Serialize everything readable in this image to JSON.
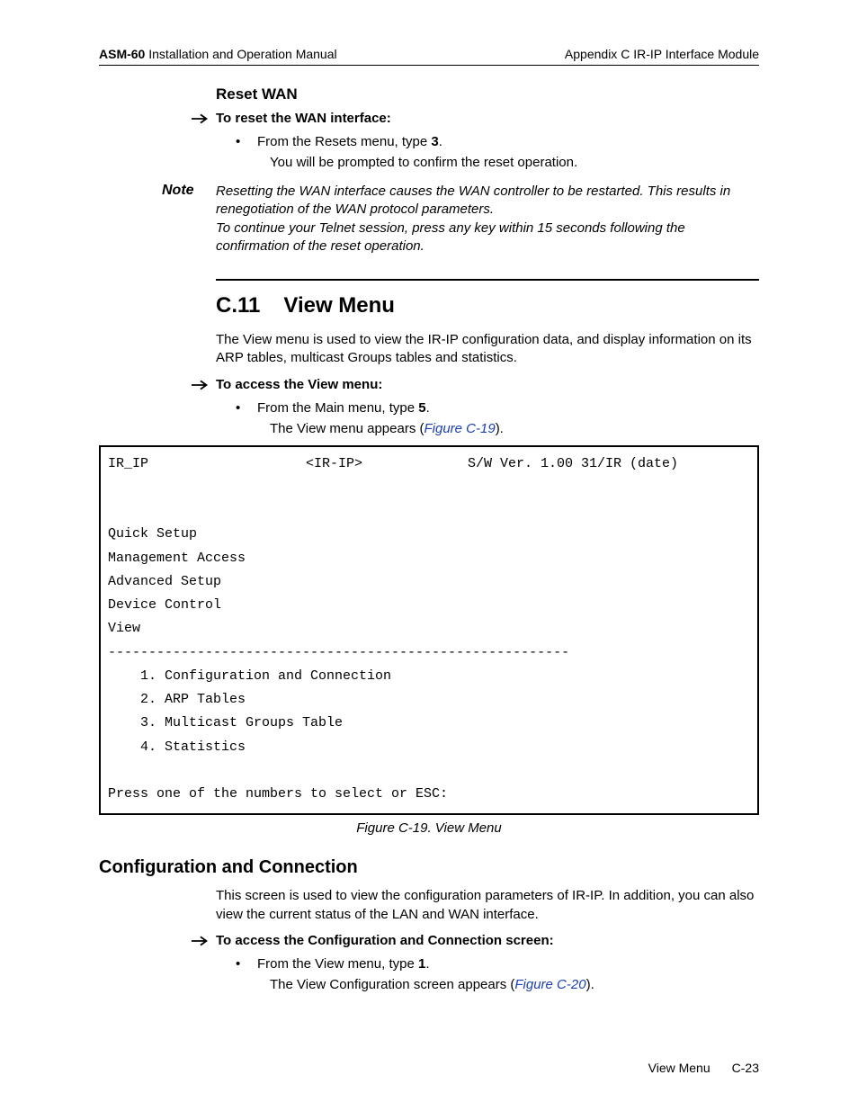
{
  "header": {
    "product": "ASM-60",
    "manual": " Installation and Operation Manual",
    "appendix": "Appendix C  IR-IP Interface Module"
  },
  "reset_wan": {
    "title": "Reset WAN",
    "proc": "To reset the WAN interface:",
    "step_pre": "From the Resets menu, type ",
    "step_bold": "3",
    "step_post": ".",
    "result": "You will be prompted to confirm the reset operation.",
    "note_label": "Note",
    "note_body1": "Resetting the WAN interface causes the WAN controller to be restarted. This results in renegotiation of the WAN protocol parameters.",
    "note_body2": "To continue your Telnet session, press any key within 15 seconds following the confirmation of the reset operation."
  },
  "section": {
    "num": "C.11",
    "title": "View Menu",
    "intro": "The View menu is used to view the IR-IP configuration data, and display information on its ARP tables, multicast Groups tables and statistics.",
    "proc": "To access the View menu:",
    "step_pre": "From the Main menu, type ",
    "step_bold": "5",
    "step_post": ".",
    "result_pre": "The View menu appears (",
    "result_ref": "Figure C-19",
    "result_post": ")."
  },
  "terminal": {
    "left": "IR_IP",
    "center": "<IR-IP>",
    "right": "S/W Ver. 1.00 31/IR (date)",
    "nav1": "Quick Setup",
    "nav2": "Management Access",
    "nav3": "Advanced Setup",
    "nav4": "Device Control",
    "nav5": "View",
    "divider": "---------------------------------------------------------",
    "opt1": "    1. Configuration and Connection",
    "opt2": "    2. ARP Tables",
    "opt3": "    3. Multicast Groups Table",
    "opt4": "    4. Statistics",
    "prompt": "Press one of the numbers to select or ESC:"
  },
  "caption": "Figure C-19.  View Menu",
  "config": {
    "title": "Configuration and Connection",
    "intro": "This screen is used to view the configuration parameters of IR-IP. In addition, you can also view the current status of the LAN and WAN interface.",
    "proc": "To access the Configuration and Connection screen:",
    "step_pre": "From the View menu, type ",
    "step_bold": "1",
    "step_post": ".",
    "result_pre": "The View Configuration screen appears (",
    "result_ref": "Figure C-20",
    "result_post": ")."
  },
  "footer": {
    "section": "View Menu",
    "page": "C-23"
  }
}
